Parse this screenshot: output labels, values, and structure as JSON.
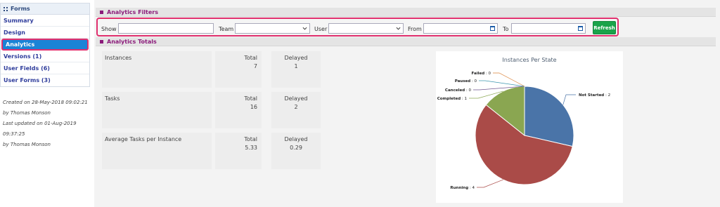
{
  "sidebar": {
    "header": "Forms",
    "items": [
      {
        "label": "Summary"
      },
      {
        "label": "Design"
      },
      {
        "label": "Analytics"
      },
      {
        "label": "Versions (1)"
      },
      {
        "label": "User Fields (6)"
      },
      {
        "label": "User Forms (3)"
      }
    ],
    "meta": {
      "created_prefix": "Created on",
      "created_date": "28-May-2018 09:02:21",
      "created_by_prefix": "by",
      "created_by": "Thomas Monson",
      "updated_prefix": "Last updated on",
      "updated_date": "01-Aug-2019 09:37:25",
      "updated_by_prefix": "by",
      "updated_by": "Thomas Monson"
    }
  },
  "filters": {
    "title": "Analytics Filters",
    "show_label": "Show",
    "show_value": "",
    "team_label": "Team",
    "team_value": "",
    "user_label": "User",
    "user_value": "",
    "from_label": "From",
    "from_value": "",
    "to_label": "To",
    "to_value": "",
    "refresh_label": "Refresh"
  },
  "totals": {
    "title": "Analytics Totals",
    "rows": [
      {
        "label": "Instances",
        "total_label": "Total",
        "total": "7",
        "delayed_label": "Delayed",
        "delayed": "1"
      },
      {
        "label": "Tasks",
        "total_label": "Total",
        "total": "16",
        "delayed_label": "Delayed",
        "delayed": "2"
      },
      {
        "label": "Average Tasks per Instance",
        "total_label": "Total",
        "total": "5.33",
        "delayed_label": "Delayed",
        "delayed": "0.29"
      }
    ]
  },
  "chart_data": {
    "type": "pie",
    "title": "Instances Per State",
    "slices": [
      {
        "label": "Not Started",
        "value": 2,
        "color": "#4a74a8"
      },
      {
        "label": "Running",
        "value": 4,
        "color": "#aa4b48"
      },
      {
        "label": "Completed",
        "value": 1,
        "color": "#8aa651"
      },
      {
        "label": "Canceled",
        "value": 0,
        "color": "#6e548d"
      },
      {
        "label": "Paused",
        "value": 0,
        "color": "#3d96ae"
      },
      {
        "label": "Failed",
        "value": 0,
        "color": "#da8137"
      }
    ]
  },
  "colors": {
    "accent_highlight": "#e0306e",
    "active_nav": "#1a83d6",
    "section_title": "#8b1a7a",
    "refresh_button": "#1aa34a"
  }
}
